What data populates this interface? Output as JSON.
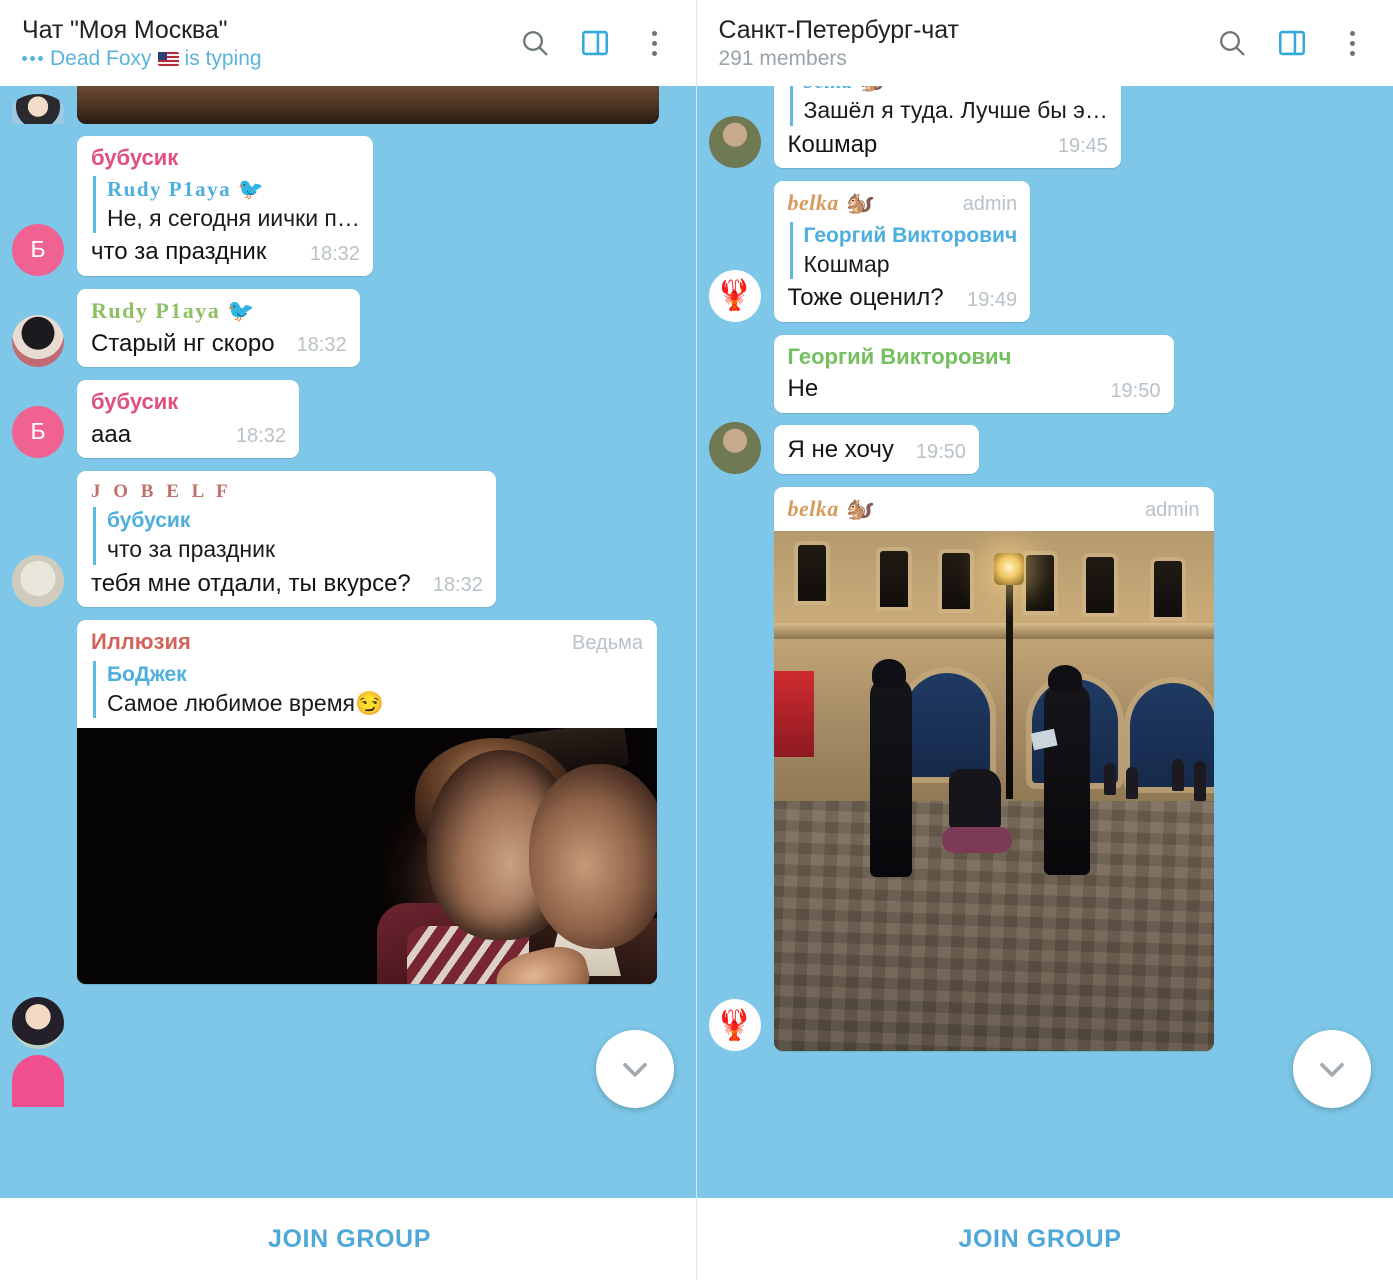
{
  "theme": {
    "chat_background": "#7ec7e8",
    "bubble_background": "#ffffff",
    "accent": "#4fa8d8",
    "time_color": "#b9c2c7"
  },
  "left_panel": {
    "header": {
      "title": "Чат \"Моя Москва\"",
      "status": "Dead Foxy",
      "status_suffix": "is typing",
      "search_icon": "search-icon",
      "split_view_icon": "split-view-icon",
      "more_icon": "more-vertical-icon"
    },
    "messages": [
      {
        "id": "m1",
        "type": "media-clipped",
        "avatar_kind": "photo-person"
      },
      {
        "id": "m2",
        "type": "text",
        "sender": "бубусик",
        "sender_color": "#e0527d",
        "avatar_kind": "letter",
        "avatar_letter": "Б",
        "avatar_color": "#f06292",
        "quote": {
          "name": "Rudy P1aya 🐦",
          "text": "Не, я сегодня иички п…"
        },
        "text": "что за праздник",
        "time": "18:32"
      },
      {
        "id": "m3",
        "type": "text",
        "sender": "Rudy P1aya 🐦",
        "sender_color": "#8fbf63",
        "sender_style": "mono",
        "avatar_kind": "photo-person",
        "text": "Старый нг скоро",
        "time": "18:32"
      },
      {
        "id": "m4",
        "type": "text",
        "sender": "бубусик",
        "sender_color": "#e0527d",
        "avatar_kind": "letter",
        "avatar_letter": "Б",
        "avatar_color": "#f06292",
        "text": "ааа",
        "time": "18:32"
      },
      {
        "id": "m5",
        "type": "text",
        "sender": "J O B E L F",
        "sender_color": "#c4706a",
        "sender_style": "wide",
        "avatar_kind": "photo-franklin",
        "quote": {
          "name": "бубусик",
          "text": "что за праздник"
        },
        "text": "тебя мне отдали, ты вкурсе?",
        "time": "18:32"
      },
      {
        "id": "m6",
        "type": "photo",
        "sender": "Иллюзия",
        "sender_color": "#d4635c",
        "badge": "Ведьма",
        "avatar_kind": "photo-woman",
        "quote": {
          "name": "БоДжек",
          "text": "Самое любимое время😏"
        },
        "photo_kind": "film-still"
      }
    ],
    "scroll_down_icon": "chevron-down-icon",
    "join_label": "JOIN GROUP"
  },
  "right_panel": {
    "header": {
      "title": "Санкт-Петербург-чат",
      "status": "291 members",
      "search_icon": "search-icon",
      "split_view_icon": "split-view-icon",
      "more_icon": "more-vertical-icon"
    },
    "messages": [
      {
        "id": "r1",
        "type": "text-clipped",
        "avatar_kind": "photo-soldier",
        "quote": {
          "name": "belka 🐿️",
          "text": "Зашёл я туда. Лучше бы э…"
        },
        "text": "Кошмар",
        "time": "19:45"
      },
      {
        "id": "r2",
        "type": "text",
        "sender": "belka 🐿️",
        "sender_color": "#d79a5b",
        "sender_style": "script",
        "badge": "admin",
        "avatar_kind": "photo-squirrel",
        "quote": {
          "name": "Георгий Викторович",
          "text": "Кошмар"
        },
        "text": "Тоже оценил?",
        "time": "19:49"
      },
      {
        "id": "r3",
        "type": "text",
        "sender": "Георгий Викторович",
        "sender_color": "#74bf5e",
        "avatar_kind": "none",
        "text": "Не",
        "time": "19:50"
      },
      {
        "id": "r4",
        "type": "text",
        "sender": "",
        "avatar_kind": "photo-soldier",
        "text": "Я не хочу",
        "time": "19:50"
      },
      {
        "id": "r5",
        "type": "photo",
        "sender": "belka 🐿️",
        "sender_color": "#d79a5b",
        "sender_style": "script",
        "badge": "admin",
        "avatar_kind": "photo-squirrel",
        "photo_kind": "street-night"
      }
    ],
    "scroll_down_icon": "chevron-down-icon",
    "join_label": "JOIN GROUP"
  }
}
